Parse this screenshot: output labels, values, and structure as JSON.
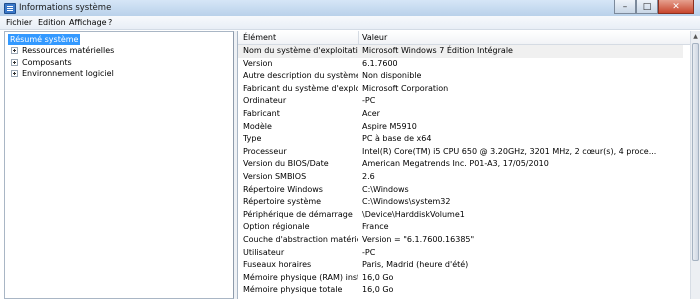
{
  "window": {
    "title": "Informations système",
    "minimize": "–",
    "maximize": "□",
    "close": "✕"
  },
  "menu": [
    "Fichier",
    "Edition",
    "Affichage",
    "?"
  ],
  "tree": {
    "root": "Résumé système",
    "children": [
      "Ressources matérielles",
      "Composants",
      "Environnement logiciel"
    ]
  },
  "table": {
    "headers": [
      "Élément",
      "Valeur"
    ],
    "rows": [
      [
        "Nom du système d'exploitation",
        "Microsoft Windows 7 Édition Intégrale"
      ],
      [
        "Version",
        "6.1.7600"
      ],
      [
        "Autre description du système d...",
        "Non disponible"
      ],
      [
        "Fabricant du système d'exploit...",
        "Microsoft Corporation"
      ],
      [
        "Ordinateur",
        "-PC"
      ],
      [
        "Fabricant",
        "Acer"
      ],
      [
        "Modèle",
        "Aspire M5910"
      ],
      [
        "Type",
        "PC à base de x64"
      ],
      [
        "Processeur",
        "Intel(R) Core(TM) i5 CPU       650  @ 3.20GHz, 3201 MHz, 2 cœur(s), 4 proce..."
      ],
      [
        "Version du BIOS/Date",
        "American Megatrends Inc. P01-A3, 17/05/2010"
      ],
      [
        "Version SMBIOS",
        "2.6"
      ],
      [
        "Répertoire Windows",
        "C:\\Windows"
      ],
      [
        "Répertoire système",
        "C:\\Windows\\system32"
      ],
      [
        "Périphérique de démarrage",
        "\\Device\\HarddiskVolume1"
      ],
      [
        "Option régionale",
        "France"
      ],
      [
        "Couche d'abstraction matérielle",
        "Version = \"6.1.7600.16385\""
      ],
      [
        "Utilisateur",
        "-PC"
      ],
      [
        "Fuseaux horaires",
        "Paris, Madrid (heure d'été)"
      ],
      [
        "Mémoire physique (RAM) instal...",
        "16,0 Go"
      ],
      [
        "Mémoire physique totale",
        "16,0 Go"
      ]
    ]
  }
}
